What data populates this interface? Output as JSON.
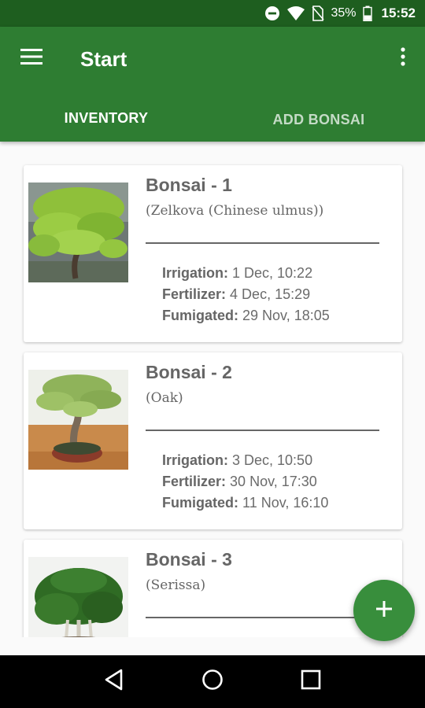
{
  "status_bar": {
    "battery": "35%",
    "time": "15:52"
  },
  "app_bar": {
    "title": "Start"
  },
  "tabs": [
    {
      "label": "INVENTORY",
      "active": true
    },
    {
      "label": "ADD BONSAI",
      "active": false
    }
  ],
  "bonsais": [
    {
      "name": "Bonsai - 1",
      "species": "(Zelkova (Chinese ulmus))",
      "irrigation_label": "Irrigation:",
      "irrigation": "1 Dec, 10:22",
      "fertilizer_label": "Fertilizer:",
      "fertilizer": "4 Dec, 15:29",
      "fumigated_label": "Fumigated:",
      "fumigated": "29 Nov, 18:05"
    },
    {
      "name": "Bonsai - 2",
      "species": "(Oak)",
      "irrigation_label": "Irrigation:",
      "irrigation": "3 Dec, 10:50",
      "fertilizer_label": "Fertilizer:",
      "fertilizer": "30 Nov, 17:30",
      "fumigated_label": "Fumigated:",
      "fumigated": "11 Nov, 16:10"
    },
    {
      "name": "Bonsai - 3",
      "species": "(Serissa)"
    }
  ],
  "colors": {
    "primary": "#2e7d32",
    "primary_dark": "#1e5e1f",
    "fab": "#388e3c"
  },
  "icons": {
    "menu": "menu-icon",
    "overflow": "more-vert-icon",
    "fab": "add-icon",
    "nav_back": "back-icon",
    "nav_home": "home-icon",
    "nav_recents": "recents-icon"
  }
}
